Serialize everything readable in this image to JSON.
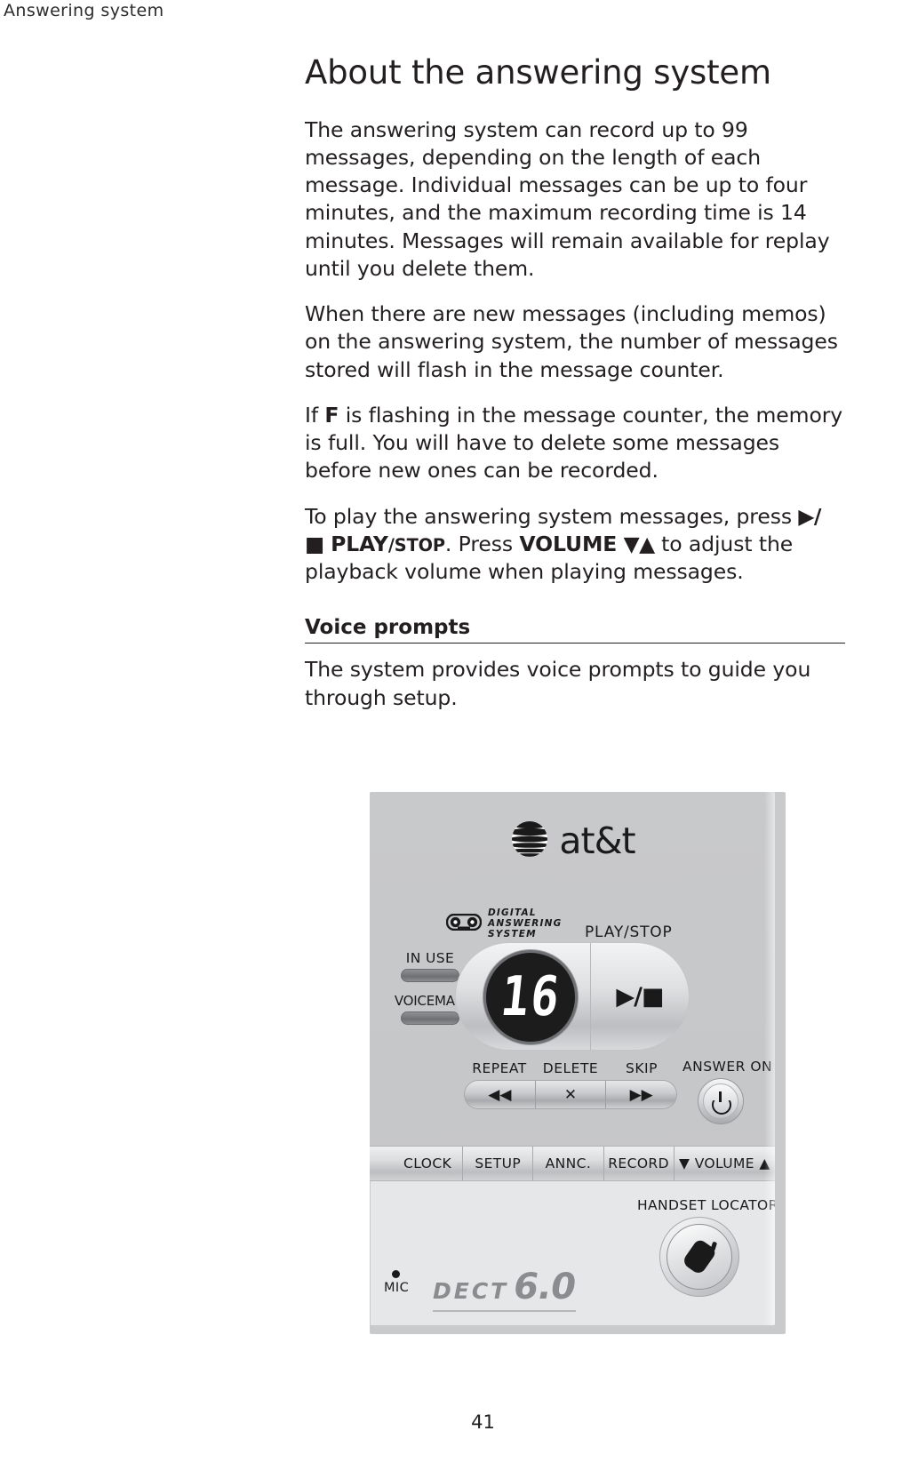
{
  "running_header": "Answering system",
  "page_number": "41",
  "article": {
    "title": "About the answering system",
    "paragraphs": [
      "The answering system can record up to 99 messages, depending on the length of each message. Individual messages can be up to four minutes, and the maximum recording time is 14 minutes. Messages will remain available for replay until you delete them.",
      "When there are new messages (including memos) on the answering system, the number of messages stored will flash in the message counter."
    ],
    "paragraph_3": {
      "lead": "If ",
      "bold_f": "F",
      "rest": " is flashing in the message counter, the memory is full. You will have to delete some messages before new ones can be recorded."
    },
    "paragraph_4": {
      "lead": "To play the answering system messages, press ",
      "play_glyph": "▶/■",
      "play_label": "PLAY",
      "slash": "/",
      "stop_label": "STOP",
      "mid": ". Press ",
      "volume_label": "VOLUME",
      "volume_glyph": "▼▲",
      "tail": " to adjust the playback volume when playing messages."
    },
    "subsection": {
      "title": "Voice prompts",
      "body": "The system provides voice prompts to guide you through setup."
    }
  },
  "device": {
    "brand_name": "at&t",
    "das_logo": {
      "line1": "DIGITAL",
      "line2": "ANSWERING",
      "line3": "SYSTEM"
    },
    "play_stop_label": "PLAY/STOP",
    "play_stop_glyph": "▶/■",
    "indicators": [
      {
        "label": "IN USE"
      },
      {
        "label": "VOICEMAIL"
      }
    ],
    "message_counter_value": "16",
    "transport": [
      {
        "label": "REPEAT",
        "glyph": "◀◀"
      },
      {
        "label": "DELETE",
        "glyph": "✕"
      },
      {
        "label": "SKIP",
        "glyph": "▶▶"
      }
    ],
    "answer_label": "ANSWER  ON",
    "answer_icon": "power-icon",
    "function_buttons": [
      "CLOCK",
      "SETUP",
      "ANNC.",
      "RECORD",
      "▼ VOLUME ▲"
    ],
    "handset_locator_label": "HANDSET LOCATOR",
    "handset_locator_icon": "handset-icon",
    "mic_label": "MIC",
    "dect": {
      "word": "DECT",
      "version": "6.0"
    }
  },
  "colors": {
    "text": "#231f20",
    "device_body": "#c7c8ca",
    "device_lower": "#e6e7e9",
    "display_bg": "#1c1c1c",
    "dect_gray": "#8b8c8f"
  }
}
